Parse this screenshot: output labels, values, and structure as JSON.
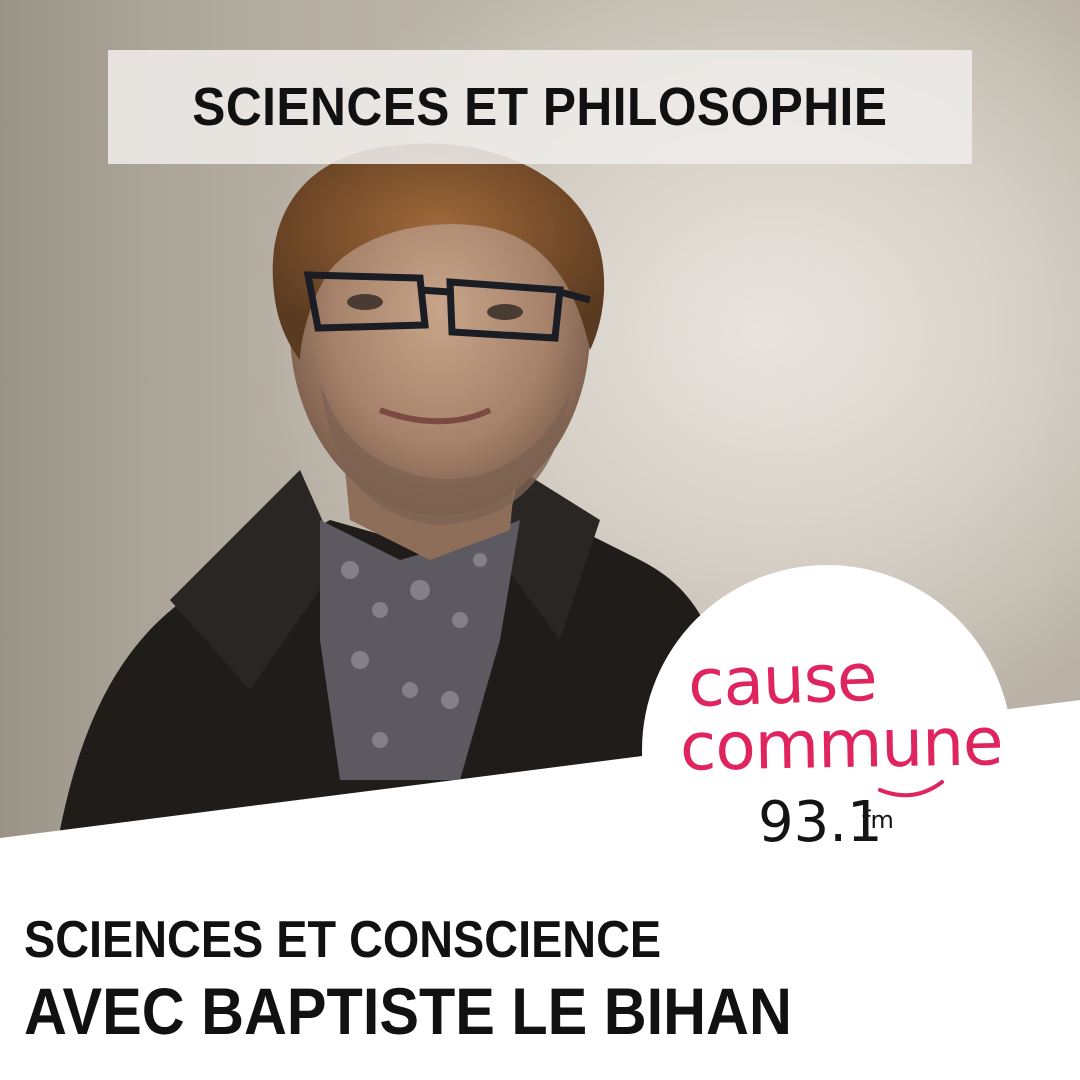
{
  "banner": {
    "category": "SCIENCES ET PHILOSOPHIE"
  },
  "logo": {
    "line1": "cause",
    "line2": "commune",
    "frequency": "93.1",
    "unit": "fm",
    "accent_color": "#e0245e"
  },
  "episode": {
    "subtitle": "SCIENCES ET CONSCIENCE",
    "title": "AVEC BAPTISTE LE BIHAN"
  },
  "photo": {
    "subject": "portrait-photo"
  }
}
